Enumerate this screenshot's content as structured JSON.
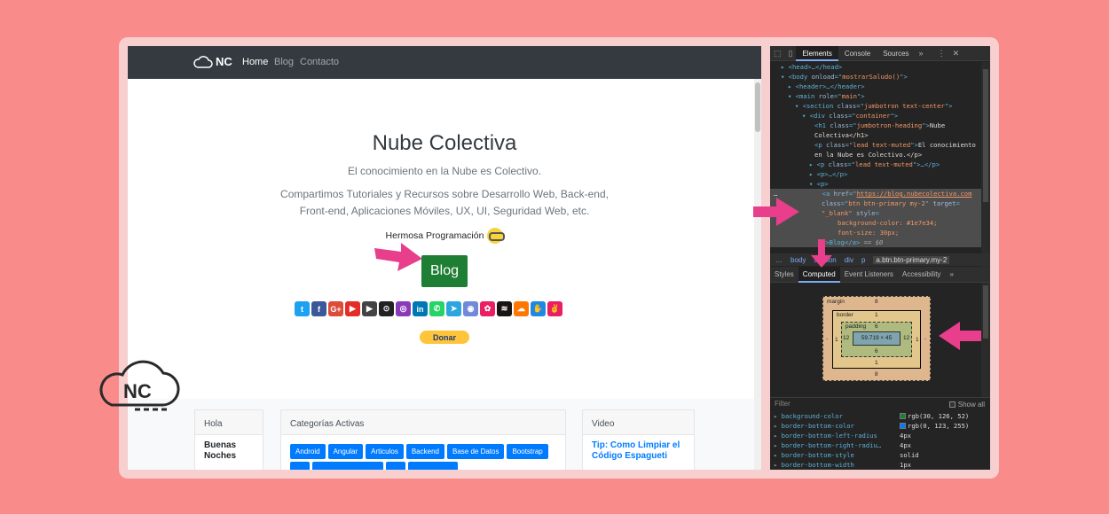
{
  "page": {
    "brand": "NC",
    "nav": [
      "Home",
      "Blog",
      "Contacto"
    ],
    "title": "Nube Colectiva",
    "lead1": "El conocimiento en la Nube es Colectivo.",
    "lead2a": "Compartimos Tutoriales y Recursos sobre Desarrollo Web, Back-end,",
    "lead2b": "Front-end, Aplicaciones Móviles, UX, UI, Seguridad Web, etc.",
    "hermosa": "Hermosa Programación",
    "blog_button": "Blog",
    "donate_button": "Donar",
    "socials": [
      {
        "icon": "twitter-icon",
        "color": "#1da1f2",
        "glyph": "t"
      },
      {
        "icon": "facebook-icon",
        "color": "#3b5998",
        "glyph": "f"
      },
      {
        "icon": "google-plus-icon",
        "color": "#dd4b39",
        "glyph": "G+"
      },
      {
        "icon": "youtube-icon",
        "color": "#e52d27",
        "glyph": "▶"
      },
      {
        "icon": "youtube-gaming-icon",
        "color": "#444",
        "glyph": "▶"
      },
      {
        "icon": "github-icon",
        "color": "#222",
        "glyph": "⊙"
      },
      {
        "icon": "instagram-icon",
        "color": "#8a3ab9",
        "glyph": "◎"
      },
      {
        "icon": "linkedin-icon",
        "color": "#0077b5",
        "glyph": "in"
      },
      {
        "icon": "whatsapp-icon",
        "color": "#25d366",
        "glyph": "✆"
      },
      {
        "icon": "telegram-icon",
        "color": "#2ca5e0",
        "glyph": "➤"
      },
      {
        "icon": "discord-icon",
        "color": "#7289da",
        "glyph": "◉"
      },
      {
        "icon": "flower-icon",
        "color": "#e91e63",
        "glyph": "✿"
      },
      {
        "icon": "spotify-icon",
        "color": "#191414",
        "glyph": "≋"
      },
      {
        "icon": "soundcloud-icon",
        "color": "#ff7700",
        "glyph": "☁"
      },
      {
        "icon": "handshake-icon",
        "color": "#1e88e5",
        "glyph": "✋"
      },
      {
        "icon": "hands-icon",
        "color": "#e91e63",
        "glyph": "✌"
      }
    ],
    "cards": {
      "hola": {
        "header": "Hola",
        "body1": "Buenas",
        "body2": "Noches"
      },
      "categorias": {
        "header": "Categorías Activas",
        "items": [
          "Android",
          "Angular",
          "Articulos",
          "Backend",
          "Base de Datos",
          "Bootstrap"
        ]
      },
      "video": {
        "header": "Video",
        "title1": "Tip: Como Limpiar el",
        "title2": "Código Espagueti"
      }
    }
  },
  "devtools": {
    "tabs": [
      "Elements",
      "Console",
      "Sources"
    ],
    "dom": {
      "l1": "<head>…</head>",
      "l2a": "<body ",
      "l2b": "onload",
      "l2c": "=\"",
      "l2d": "mostrarSaludo()",
      "l2e": "\">",
      "l3": "<header>…</header>",
      "l4a": "<main ",
      "l4b": "role",
      "l4c": "main",
      "l5a": "<section ",
      "l5b": "class",
      "l5c": "jumbotron text-center",
      "l6a": "<div ",
      "l6b": "class",
      "l6c": "container",
      "l7a": "<h1 ",
      "l7b": "class",
      "l7c": "jumbotron-heading",
      "l7d": "Nube",
      "l8": "Colectiva</h1>",
      "l9a": "<p ",
      "l9b": "class",
      "l9c": "lead text-muted",
      "l9d": "El conocimiento",
      "l10": "en la Nube es Colectivo.</p>",
      "l11a": "<p ",
      "l11b": "class",
      "l11c": "lead text-muted",
      "l11d": "…</p>",
      "l12": "<p>…</p>",
      "l13": "<p>",
      "l14a": "<a ",
      "l14b": "href",
      "l14c": "https://blog.nubecolectiva.com",
      "l15a": "class",
      "l15b": "btn btn-primary my-2",
      "l15c": "target",
      "l16a": "_blank",
      "l16b": "style",
      "l17": "background-color: #1e7e34;",
      "l18": "font-size: 30px;",
      "l19a": "\">Blog</a>",
      "l19b": " == $0"
    },
    "crumbs": [
      "…",
      "body",
      "section",
      "div",
      "p",
      "a.btn.btn-primary.my-2"
    ],
    "subtabs": [
      "Styles",
      "Computed",
      "Event Listeners",
      "Accessibility"
    ],
    "box_model": {
      "margin_label": "margin",
      "margin_top": "8",
      "margin_bottom": "8",
      "margin_left": "-",
      "margin_right": "-",
      "border_label": "border",
      "border_top": "1",
      "border_bottom": "1",
      "border_left": "1",
      "border_right": "1",
      "padding_label": "padding",
      "padding_top": "6",
      "padding_bottom": "6",
      "padding_left": "12",
      "padding_right": "12",
      "content": "59.719 × 45"
    },
    "filter_placeholder": "Filter",
    "show_all": "Show all",
    "computed": [
      {
        "name": "background-color",
        "value": "rgb(30, 126, 52)",
        "swatch": "#1e7e34"
      },
      {
        "name": "border-bottom-color",
        "value": "rgb(0, 123, 255)",
        "swatch": "#007bff"
      },
      {
        "name": "border-bottom-left-radius",
        "value": "4px",
        "swatch": ""
      },
      {
        "name": "border-bottom-right-radiu…",
        "value": "4px",
        "swatch": ""
      },
      {
        "name": "border-bottom-style",
        "value": "solid",
        "swatch": ""
      },
      {
        "name": "border-bottom-width",
        "value": "1px",
        "swatch": ""
      }
    ]
  },
  "colors": {
    "arrow": "#e83e8c",
    "background": "#f98b8b",
    "button": "#1e7e34"
  }
}
